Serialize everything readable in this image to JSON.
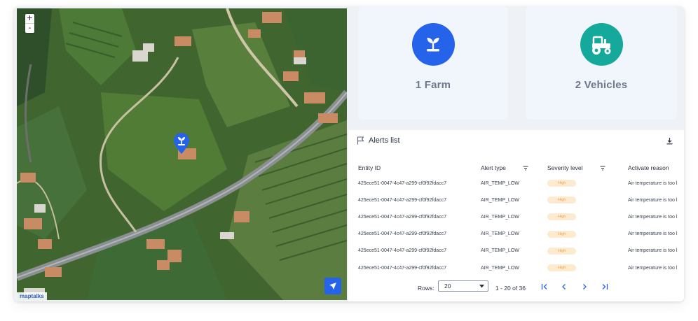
{
  "map": {
    "zoom_in": "+",
    "zoom_out": "-",
    "attribution": "maptalks",
    "marker_icon": "sprout-icon",
    "locate_icon": "cursor-arrow-icon"
  },
  "stats": {
    "farm": {
      "label": "1 Farm",
      "icon": "sprout-icon",
      "color": "#2563eb"
    },
    "vehicles": {
      "label": "2 Vehicles",
      "icon": "tractor-icon",
      "color": "#14a99a"
    }
  },
  "alerts": {
    "title": "Alerts list",
    "columns": {
      "entity_id": "Entity ID",
      "alert_type": "Alert type",
      "severity": "Severity level",
      "reason": "Activate reason"
    },
    "rows": [
      {
        "entity_id": "425ece51-0047-4c47-a299-cf0f92fdacc7",
        "alert_type": "AIR_TEMP_LOW",
        "severity": "High",
        "reason": "Air temperature is too l"
      },
      {
        "entity_id": "425ece51-0047-4c47-a299-cf0f92fdacc7",
        "alert_type": "AIR_TEMP_LOW",
        "severity": "High",
        "reason": "Air temperature is too l"
      },
      {
        "entity_id": "425ece51-0047-4c47-a299-cf0f92fdacc7",
        "alert_type": "AIR_TEMP_LOW",
        "severity": "High",
        "reason": "Air temperature is too l"
      },
      {
        "entity_id": "425ece51-0047-4c47-a299-cf0f92fdacc7",
        "alert_type": "AIR_TEMP_LOW",
        "severity": "High",
        "reason": "Air temperature is too l"
      },
      {
        "entity_id": "425ece51-0047-4c47-a299-cf0f92fdacc7",
        "alert_type": "AIR_TEMP_LOW",
        "severity": "High",
        "reason": "Air temperature is too l"
      },
      {
        "entity_id": "425ece51-0047-4c47-a299-cf0f92fdacc7",
        "alert_type": "AIR_TEMP_LOW",
        "severity": "High",
        "reason": "Air temperature is too l"
      }
    ],
    "pagination": {
      "rows_label": "Rows:",
      "rows_value": "20",
      "range": "1 - 20 of 36"
    }
  }
}
